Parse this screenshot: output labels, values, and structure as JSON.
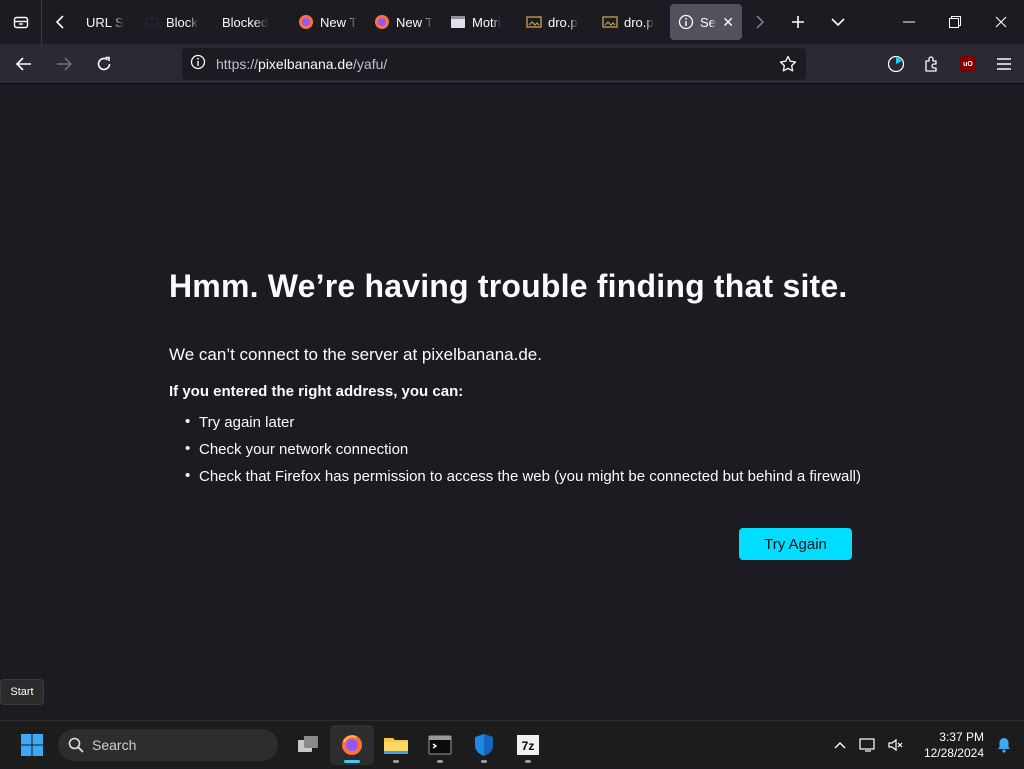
{
  "tabs": [
    {
      "label": "URL S",
      "favicon": "none",
      "active": false
    },
    {
      "label": "Block",
      "favicon": "dark-icon",
      "active": false
    },
    {
      "label": "Blocked",
      "favicon": "none",
      "active": false
    },
    {
      "label": "New T",
      "favicon": "firefox",
      "active": false
    },
    {
      "label": "New T",
      "favicon": "firefox",
      "active": false
    },
    {
      "label": "Motri",
      "favicon": "window-icon",
      "active": false
    },
    {
      "label": "dro.p",
      "favicon": "folder-image",
      "active": false
    },
    {
      "label": "dro.p",
      "favicon": "folder-image",
      "active": false
    },
    {
      "label": "Ser",
      "favicon": "info-icon",
      "active": true
    }
  ],
  "urlbar": {
    "scheme": "https://",
    "host": "pixelbanana.de",
    "path": "/yafu/"
  },
  "error": {
    "title": "Hmm. We’re having trouble finding that site.",
    "message": "We can’t connect to the server at pixelbanana.de.",
    "subtitle": "If you entered the right address, you can:",
    "items": [
      "Try again later",
      "Check your network connection",
      "Check that Firefox has permission to access the web (you might be connected but behind a firewall)"
    ],
    "button": "Try Again"
  },
  "tooltip": "Start",
  "taskbar": {
    "search_placeholder": "Search",
    "time": "3:37 PM",
    "date": "12/28/2024"
  },
  "colors": {
    "accent": "#00ddff",
    "background": "#1c1b22",
    "toolbar": "#2b2a33"
  }
}
